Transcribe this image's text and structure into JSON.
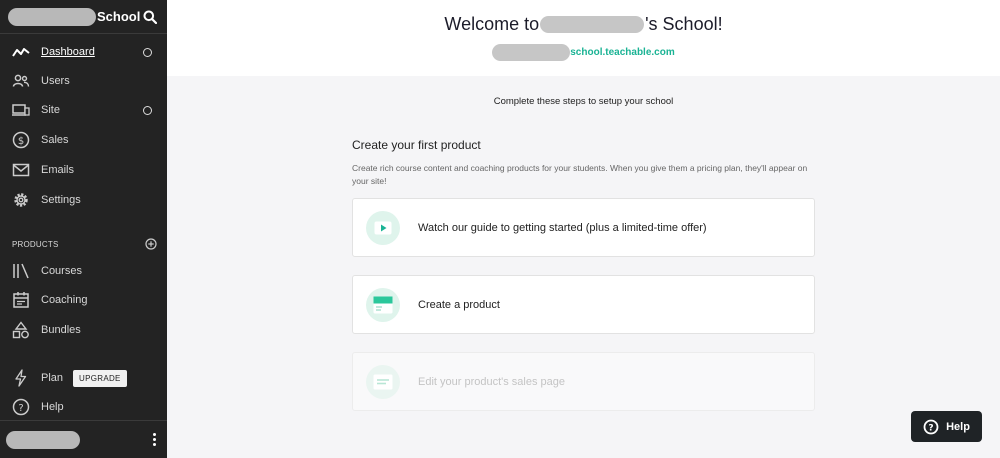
{
  "sidebar": {
    "school_suffix": "School",
    "nav": [
      {
        "label": "Dashboard",
        "icon": "activity-icon",
        "status": true
      },
      {
        "label": "Users",
        "icon": "users-icon",
        "status": false
      },
      {
        "label": "Site",
        "icon": "devices-icon",
        "status": true
      },
      {
        "label": "Sales",
        "icon": "dollar-icon",
        "status": false
      },
      {
        "label": "Emails",
        "icon": "mail-icon",
        "status": false
      },
      {
        "label": "Settings",
        "icon": "gear-icon",
        "status": false
      }
    ],
    "products_header": "PRODUCTS",
    "products": [
      {
        "label": "Courses",
        "icon": "library-icon"
      },
      {
        "label": "Coaching",
        "icon": "calendar-icon"
      },
      {
        "label": "Bundles",
        "icon": "shapes-icon"
      }
    ],
    "plan": {
      "label": "Plan",
      "badge": "UPGRADE"
    },
    "help_label": "Help"
  },
  "main": {
    "welcome_prefix": "Welcome to",
    "welcome_suffix": "'s School!",
    "url_suffix": "school.teachable.com",
    "steps_text": "Complete these steps to setup your school",
    "section_title": "Create your first product",
    "section_desc": "Create rich course content and coaching products for your students. When you give them a pricing plan, they'll appear on your site!",
    "cards": [
      {
        "label": "Watch our guide to getting started (plus a limited-time offer)",
        "icon": "video-play-icon"
      },
      {
        "label": "Create a product",
        "icon": "product-page-icon"
      },
      {
        "label": "Edit your product's sales page",
        "icon": "sales-page-icon"
      }
    ]
  },
  "help_button": {
    "label": "Help"
  },
  "colors": {
    "sidebar_bg": "#232323",
    "accent": "#1ab394",
    "help_bg": "#1f2326"
  }
}
